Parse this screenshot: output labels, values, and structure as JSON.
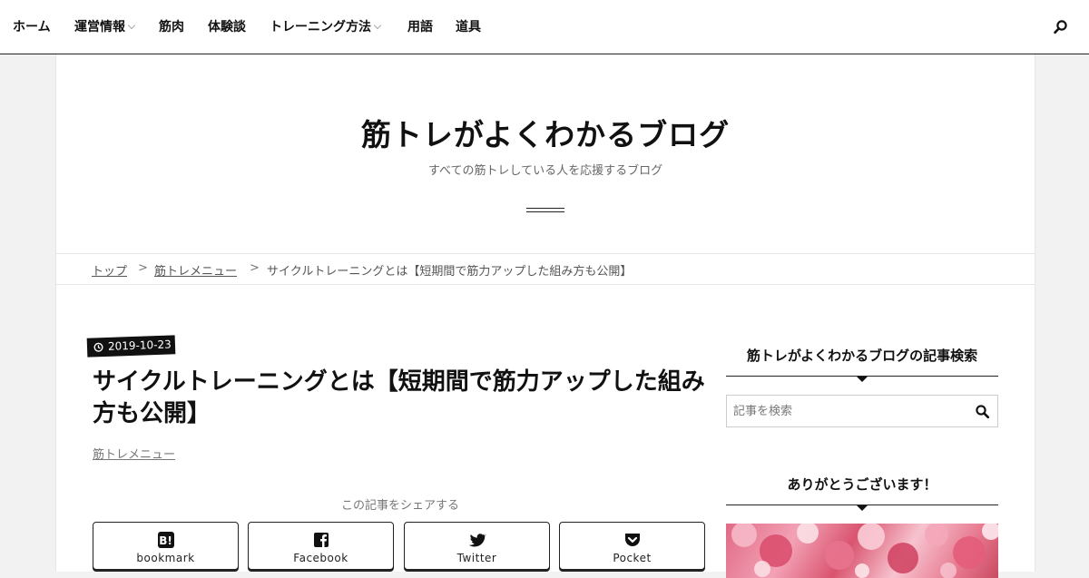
{
  "nav": {
    "items": [
      {
        "label": "ホーム",
        "has_dropdown": false
      },
      {
        "label": "運営情報",
        "has_dropdown": true
      },
      {
        "label": "筋肉",
        "has_dropdown": false
      },
      {
        "label": "体験談",
        "has_dropdown": false
      },
      {
        "label": "トレーニング方法",
        "has_dropdown": true
      },
      {
        "label": "用語",
        "has_dropdown": false
      },
      {
        "label": "道具",
        "has_dropdown": false
      }
    ],
    "search_icon": "search-icon"
  },
  "header": {
    "site_title": "筋トレがよくわかるブログ",
    "site_description": "すべての筋トレしている人を応援するブログ"
  },
  "breadcrumb": {
    "items": [
      "トップ",
      "筋トレメニュー",
      "サイクルトレーニングとは【短期間で筋力アップした組み方も公開】"
    ],
    "separator": ">"
  },
  "article": {
    "date": "2019-10-23",
    "title": "サイクルトレーニングとは【短期間で筋力アップした組み方も公開】",
    "category": "筋トレメニュー",
    "share_label": "この記事をシェアする",
    "share_buttons": [
      {
        "label": "bookmark",
        "icon": "hatena-bookmark-icon"
      },
      {
        "label": "Facebook",
        "icon": "facebook-icon"
      },
      {
        "label": "Twitter",
        "icon": "twitter-icon"
      },
      {
        "label": "Pocket",
        "icon": "pocket-icon"
      }
    ]
  },
  "sidebar": {
    "search_widget_title": "筋トレがよくわかるブログの記事検索",
    "search_placeholder": "記事を検索",
    "thanks_widget_title": "ありがとうございます！"
  },
  "colors": {
    "accent": "#111111",
    "background": "#f2f2f2",
    "card": "#ffffff"
  }
}
